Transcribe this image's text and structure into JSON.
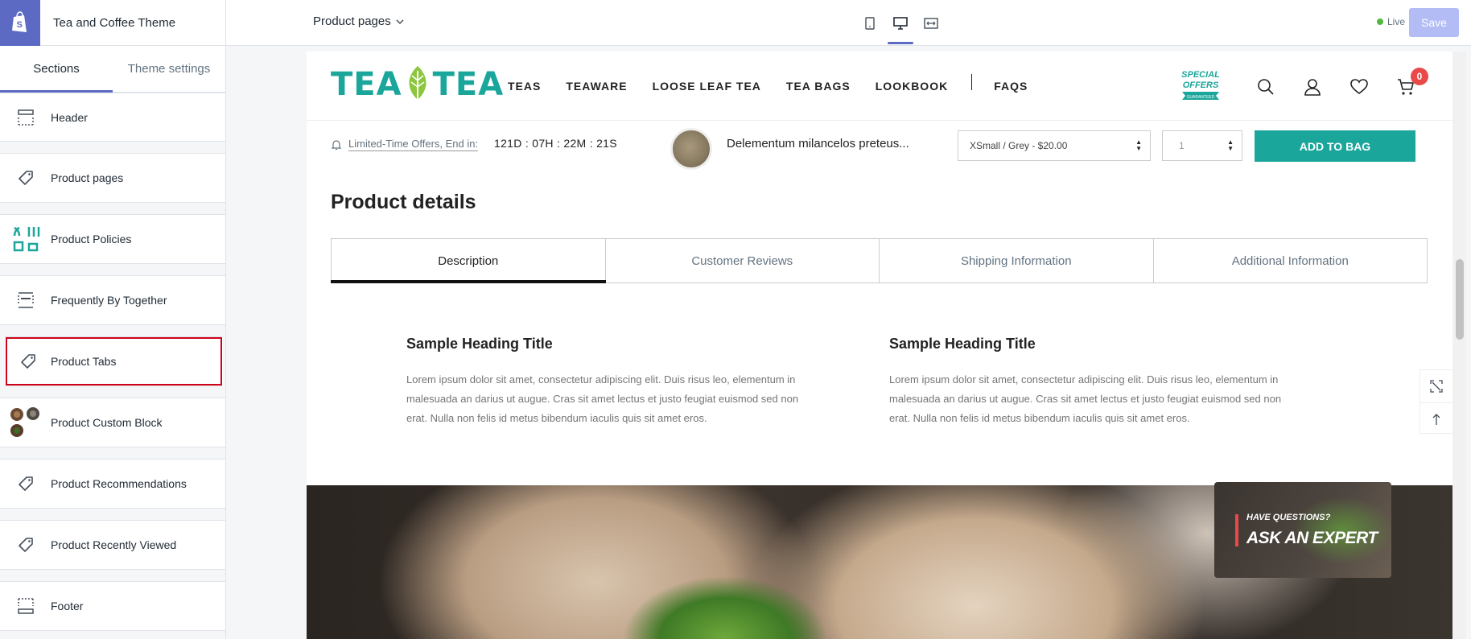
{
  "editor": {
    "theme_name": "Tea and Coffee Theme",
    "tabs": [
      {
        "label": "Sections"
      },
      {
        "label": "Theme settings"
      }
    ],
    "sections": [
      {
        "label": "Header"
      },
      {
        "label": "Product pages"
      },
      {
        "label": "Product Policies"
      },
      {
        "label": "Frequently By Together"
      },
      {
        "label": "Product Tabs"
      },
      {
        "label": "Product Custom Block"
      },
      {
        "label": "Product Recommendations"
      },
      {
        "label": "Product Recently Viewed"
      },
      {
        "label": "Footer"
      }
    ],
    "page_select": "Product pages",
    "live_label": "Live",
    "save_label": "Save",
    "accent": "#5c6ac4",
    "highlight": "#d0021b"
  },
  "store": {
    "logo_left": "TEA",
    "logo_right": "TEA",
    "nav": [
      "TEAS",
      "TEAWARE",
      "LOOSE LEAF TEA",
      "TEA BAGS",
      "LOOKBOOK",
      "FAQS"
    ],
    "special_offers": [
      "SPECIAL",
      "OFFERS",
      "GUARANTEED"
    ],
    "cart_count": "0",
    "brand_color": "#1ba69b",
    "sticky": {
      "offer_text": "Limited-Time Offers, End in:",
      "countdown": "121D : 07H : 22M : 21S",
      "product_name": "Delementum milancelos preteus...",
      "variant": "XSmall / Grey - $20.00",
      "quantity": "1",
      "add_to_bag": "ADD TO BAG"
    },
    "product_details": {
      "title": "Product details",
      "tabs": [
        {
          "label": "Description"
        },
        {
          "label": "Customer Reviews"
        },
        {
          "label": "Shipping Information"
        },
        {
          "label": "Additional Information"
        }
      ],
      "columns": [
        {
          "heading": "Sample Heading Title",
          "body": "Lorem ipsum dolor sit amet, consectetur adipiscing elit. Duis risus leo, elementum in malesuada an darius ut augue. Cras sit amet lectus et justo feugiat euismod sed non erat. Nulla non felis id metus bibendum iaculis quis sit amet eros."
        },
        {
          "heading": "Sample Heading Title",
          "body": "Lorem ipsum dolor sit amet, consectetur adipiscing elit. Duis risus leo, elementum in malesuada an darius ut augue. Cras sit amet lectus et justo feugiat euismod sed non erat. Nulla non felis id metus bibendum iaculis quis sit amet eros."
        }
      ]
    },
    "expert": {
      "question": "HAVE QUESTIONS?",
      "cta": "ASK AN EXPERT"
    }
  }
}
